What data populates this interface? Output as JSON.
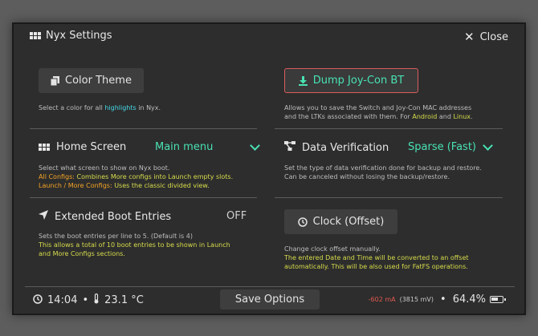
{
  "window": {
    "title": "Nyx Settings",
    "close_label": "Close"
  },
  "color_theme": {
    "button_label": "Color Theme",
    "desc_prefix": "Select a color for all ",
    "desc_highlight": "highlights",
    "desc_suffix": " in Nyx."
  },
  "dump_joycon": {
    "button_label": "Dump Joy-Con BT",
    "desc_line1": "Allows you to save the Switch and Joy-Con MAC addresses",
    "desc_line2_prefix": "and the LTKs associated with them. For ",
    "desc_android": "Android",
    "desc_and": " and ",
    "desc_linux": "Linux",
    "desc_end": "."
  },
  "home_screen": {
    "label": "Home Screen",
    "value": "Main menu",
    "desc_line1": "Select what screen to show on Nyx boot.",
    "all_configs_label": "All Configs:",
    "all_configs_text": " Combines More configs into Launch empty slots.",
    "launch_more_label": "Launch / More Configs:",
    "launch_more_text": " Uses the classic divided view."
  },
  "data_verification": {
    "label": "Data Verification",
    "value": "Sparse (Fast)",
    "desc_line1": "Set the type of data verification done for backup and restore.",
    "desc_line2": "Can be canceled without losing the backup/restore."
  },
  "extended_boot": {
    "label": "Extended Boot Entries",
    "value": "OFF",
    "desc_line1": "Sets the boot entries per line to 5. (Default is 4)",
    "desc_line2": "This allows a total of 10 boot entries to be shown in Launch",
    "desc_line3": "and More Configs sections."
  },
  "clock": {
    "button_label": "Clock (Offset)",
    "desc_line1": "Change clock offset manually.",
    "desc_line2": "The entered Date and Time will be converted to an offset",
    "desc_line3": "automatically. This will be also used for FatFS operations."
  },
  "status": {
    "time": "14:04",
    "sep": "•",
    "temperature": "23.1 °C",
    "save_label": "Save Options",
    "current": "-602 mA",
    "voltage": "(3815 mV)",
    "battery_percent": "64.4%",
    "battery_level": 0.644
  },
  "colors": {
    "accent": "#48e2b2",
    "highlight_cyan": "#45d8e8",
    "orange": "#f4a324",
    "yellow": "#d7dc4b",
    "red": "#e05a50"
  },
  "icons": [
    "grid-icon",
    "close-icon",
    "copy-icon",
    "download-icon",
    "grid-icon",
    "chevron-down-icon",
    "network-icon",
    "location-arrow-icon",
    "clock-icon",
    "thermometer-icon",
    "battery-icon"
  ]
}
